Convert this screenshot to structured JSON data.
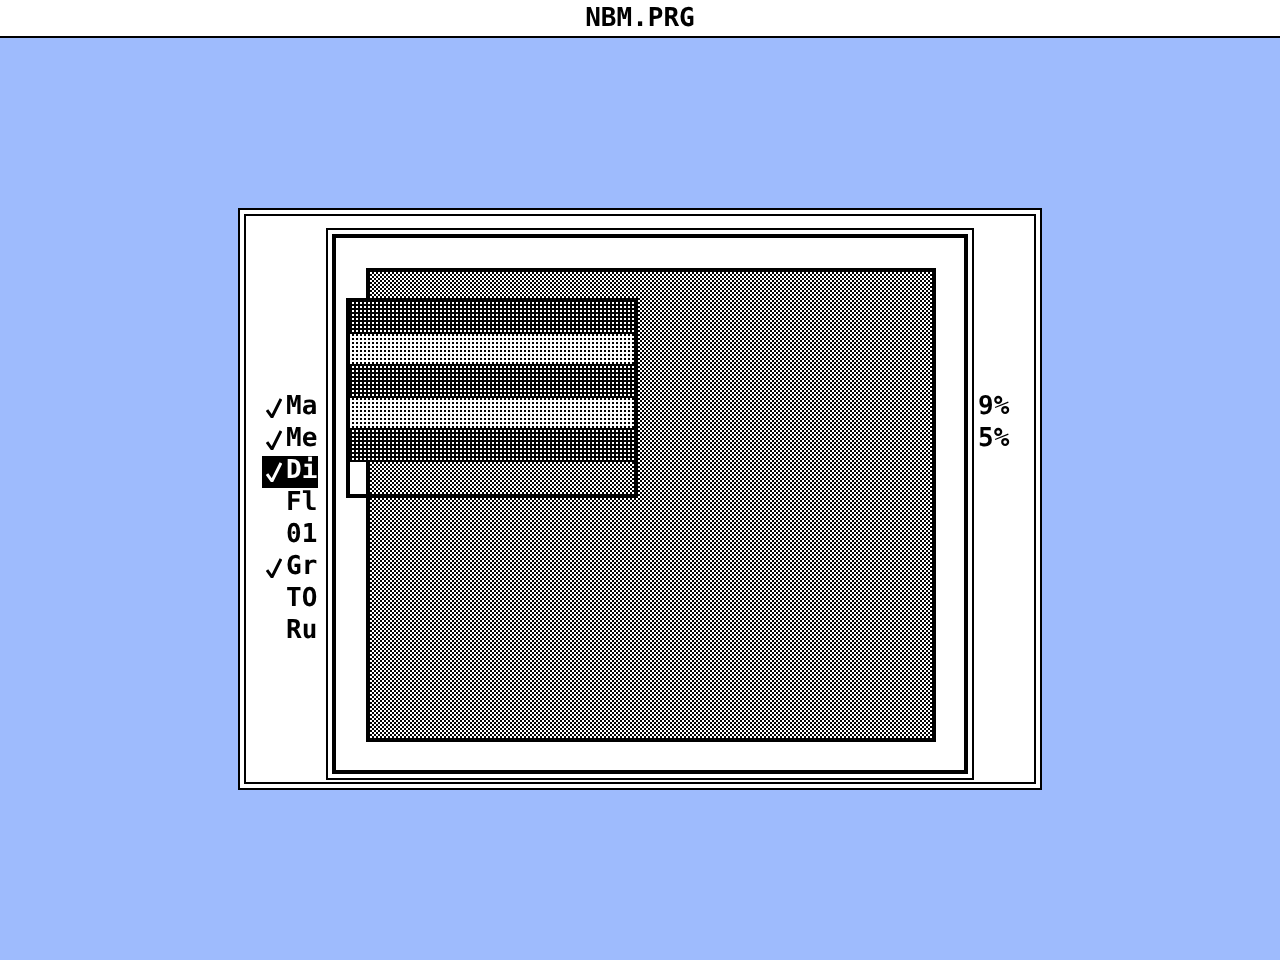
{
  "window": {
    "title": "NBM.PRG"
  },
  "options": [
    {
      "label": "Ma",
      "checked": true,
      "selected": false
    },
    {
      "label": "Me",
      "checked": true,
      "selected": false
    },
    {
      "label": "Di",
      "checked": true,
      "selected": true
    },
    {
      "label": "Fl",
      "checked": false,
      "selected": false
    },
    {
      "label": "01",
      "checked": false,
      "selected": false
    },
    {
      "label": "Gr",
      "checked": true,
      "selected": false
    },
    {
      "label": "TO",
      "checked": false,
      "selected": false
    },
    {
      "label": "Ru",
      "checked": false,
      "selected": false
    }
  ],
  "values": [
    "9%",
    "5%"
  ],
  "preview": {
    "kind": "medium"
  },
  "patterns": [
    {
      "kind": "dense",
      "marked": false
    },
    {
      "kind": "sparse",
      "marked": false
    },
    {
      "kind": "dense",
      "marked": false
    },
    {
      "kind": "sparse",
      "marked": false
    },
    {
      "kind": "dense",
      "marked": false
    },
    {
      "kind": "medium",
      "marked": true
    }
  ]
}
